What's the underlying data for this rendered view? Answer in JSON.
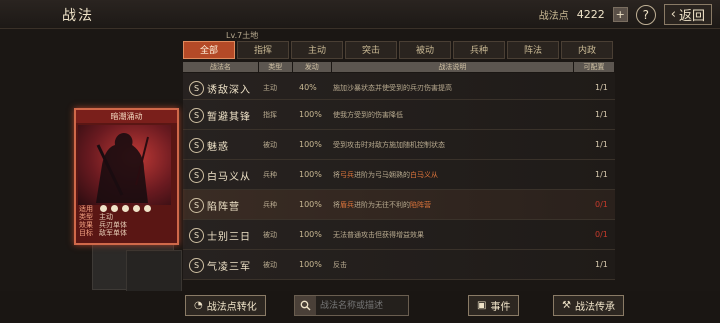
{
  "header": {
    "title": "战法",
    "points_label": "战法点",
    "points_value": "4222",
    "help": "?",
    "back_label": "返回"
  },
  "level_text": "Lv.7土地",
  "tabs": [
    "全部",
    "指挥",
    "主动",
    "突击",
    "被动",
    "兵种",
    "阵法",
    "内政"
  ],
  "table": {
    "headers": [
      "战法名",
      "类型",
      "发动",
      "战法说明",
      "可配置"
    ],
    "rows": [
      {
        "badge": "S",
        "name": "诱敌深入",
        "type": "主动",
        "pct": "40%",
        "desc": "施加沙暴状态并使受到的兵刃伤害提高",
        "cfg": "1/1",
        "cfg_color": "normal"
      },
      {
        "badge": "S",
        "name": "暂避其锋",
        "type": "指挥",
        "pct": "100%",
        "desc": "使我方受到的伤害降低",
        "cfg": "1/1",
        "cfg_color": "normal"
      },
      {
        "badge": "S",
        "name": "魅惑",
        "type": "被动",
        "pct": "100%",
        "desc": "受到攻击时对敌方施加随机控制状态",
        "cfg": "1/1",
        "cfg_color": "normal"
      },
      {
        "badge": "S",
        "name": "白马义从",
        "type": "兵种",
        "pct": "100%",
        "desc_pre": "将",
        "desc_hi1": "弓兵",
        "desc_mid": "进阶为弓马娴熟的",
        "desc_hi2": "白马义从",
        "cfg": "1/1",
        "cfg_color": "normal"
      },
      {
        "badge": "S",
        "name": "陷阵营",
        "type": "兵种",
        "pct": "100%",
        "desc_pre": "将",
        "desc_hi1": "盾兵",
        "desc_mid": "进阶为无往不利的",
        "desc_hi2": "陷阵营",
        "cfg": "0/1",
        "cfg_color": "red"
      },
      {
        "badge": "S",
        "name": "士别三日",
        "type": "被动",
        "pct": "100%",
        "desc": "无法普通攻击但获得增益效果",
        "cfg": "0/1",
        "cfg_color": "red"
      },
      {
        "badge": "S",
        "name": "气凌三军",
        "type": "被动",
        "pct": "100%",
        "desc": "反击",
        "cfg": "1/1",
        "cfg_color": "normal"
      }
    ]
  },
  "card": {
    "title": "暗潮涌动",
    "stats": [
      {
        "k": "适用",
        "v": ""
      },
      {
        "k": "类型",
        "v": "主动"
      },
      {
        "k": "效果",
        "v": "兵刃单体"
      },
      {
        "k": "目标",
        "v": "敌军单体"
      }
    ]
  },
  "bottom": {
    "convert_label": "战法点转化",
    "search_placeholder": "战法名称或描述",
    "events_label": "事件",
    "inherit_label": "战法传承"
  },
  "colors": {
    "accent": "#b44a27",
    "highlight": "#e0763c",
    "alert": "#c73a2b"
  }
}
